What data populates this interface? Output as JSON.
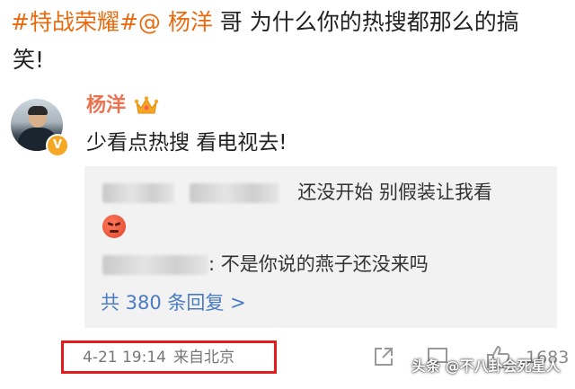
{
  "post": {
    "topic": "#特战荣耀#",
    "mention": "@ 杨洋",
    "text_line1": " 哥 为什么你的热搜都那么的搞",
    "text_line2": "笑!"
  },
  "reply": {
    "author": "杨洋",
    "verified_badge": "V",
    "text": "少看点热搜 看电视去!"
  },
  "sub_replies": [
    {
      "text": "还没开始 别假装让我看"
    },
    {
      "text": ": 不是你说的燕子还没来吗"
    }
  ],
  "more_replies_label": "共 380 条回复 >",
  "meta": {
    "time": "4-21 19:14",
    "source": "来自北京"
  },
  "actions": {
    "share_icon": "share-icon",
    "comment_icon": "comment-icon",
    "like_icon": "like-icon",
    "like_count": "1683"
  },
  "watermark": "头条 @不八卦会死星人",
  "colors": {
    "topic": "#e86b0f",
    "author_name": "#eb7350",
    "link": "#4a7cc1",
    "highlight_box": "#e01c1c"
  }
}
